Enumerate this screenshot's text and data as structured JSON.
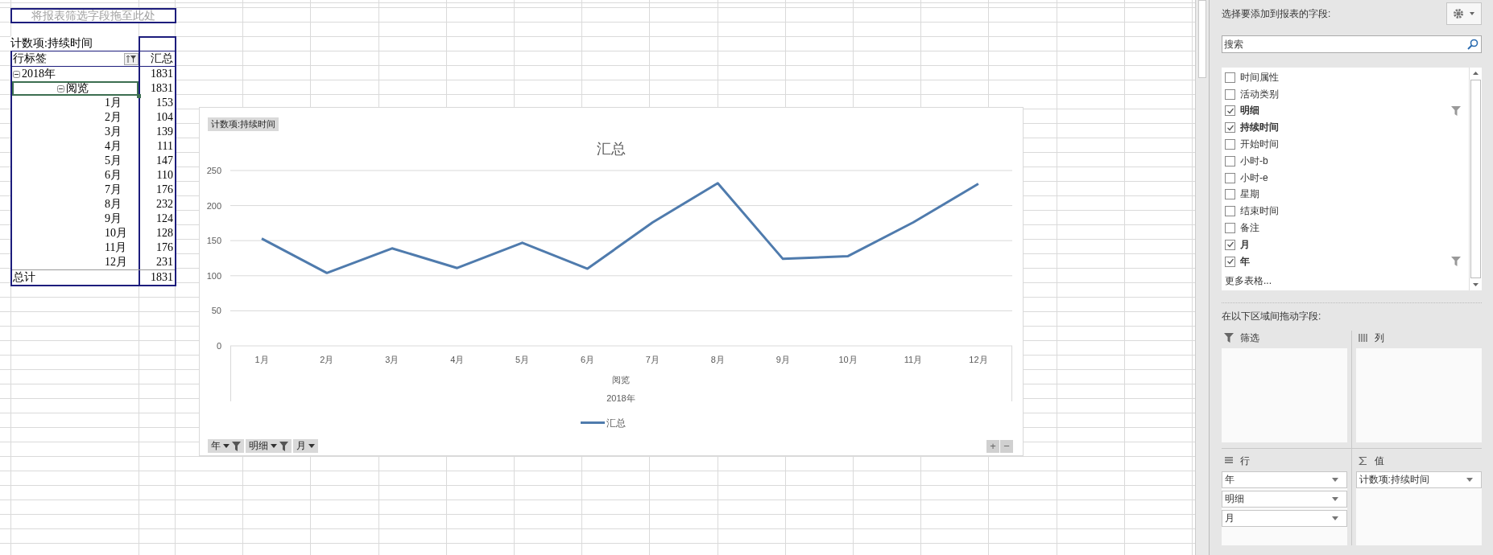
{
  "sheet": {
    "filter_drop_zone": "将报表筛选字段拖至此处",
    "pivot": {
      "value_caption": "计数项:持续时间",
      "header": {
        "row_label": "行标签",
        "total": "汇总"
      },
      "rows": [
        {
          "label": "2018年",
          "total": "1831",
          "expanded": true,
          "selected": false,
          "children": [
            {
              "label": "阅览",
              "total": "1831",
              "expanded": true,
              "selected": true,
              "children": [
                {
                  "label": "1月",
                  "total": "153",
                  "selected": false
                },
                {
                  "label": "2月",
                  "total": "104",
                  "selected": false
                },
                {
                  "label": "3月",
                  "total": "139",
                  "selected": false
                },
                {
                  "label": "4月",
                  "total": "111",
                  "selected": false
                },
                {
                  "label": "5月",
                  "total": "147",
                  "selected": false
                },
                {
                  "label": "6月",
                  "total": "110",
                  "selected": false
                },
                {
                  "label": "7月",
                  "total": "176",
                  "selected": false
                },
                {
                  "label": "8月",
                  "total": "232",
                  "selected": false
                },
                {
                  "label": "9月",
                  "total": "124",
                  "selected": false
                },
                {
                  "label": "10月",
                  "total": "128",
                  "selected": false
                },
                {
                  "label": "11月",
                  "total": "176",
                  "selected": false
                },
                {
                  "label": "12月",
                  "total": "231",
                  "selected": false
                }
              ]
            }
          ]
        }
      ],
      "grand_total": {
        "label": "总计",
        "total": "1831"
      }
    }
  },
  "chart": {
    "field_button": "计数项:持续时间",
    "chart_data": {
      "type": "line",
      "title": "汇总",
      "categories": [
        "1月",
        "2月",
        "3月",
        "4月",
        "5月",
        "6月",
        "7月",
        "8月",
        "9月",
        "10月",
        "11月",
        "12月"
      ],
      "series": [
        {
          "name": "汇总",
          "color": "#4f7bad",
          "values": [
            153,
            104,
            139,
            111,
            147,
            110,
            176,
            232,
            124,
            128,
            176,
            231
          ]
        }
      ],
      "ylim": [
        0,
        250
      ],
      "grid": true,
      "yticks": [
        0,
        50,
        100,
        150,
        200,
        250
      ]
    },
    "category_groups": [
      "阅览",
      "2018年"
    ],
    "axis_fields": [
      {
        "label": "年",
        "filtered": true
      },
      {
        "label": "明细",
        "filtered": true
      },
      {
        "label": "月",
        "filtered": false
      }
    ],
    "zoom_buttons": [
      "+",
      "−"
    ]
  },
  "field_list": {
    "title": "选择要添加到报表的字段:",
    "search": {
      "placeholder": "搜索"
    },
    "fields": [
      {
        "label": "时间属性",
        "checked": false,
        "filtered": false
      },
      {
        "label": "活动类别",
        "checked": false,
        "filtered": false
      },
      {
        "label": "明细",
        "checked": true,
        "filtered": true
      },
      {
        "label": "持续时间",
        "checked": true,
        "filtered": false
      },
      {
        "label": "开始时间",
        "checked": false,
        "filtered": false
      },
      {
        "label": "小时-b",
        "checked": false,
        "filtered": false
      },
      {
        "label": "小时-e",
        "checked": false,
        "filtered": false
      },
      {
        "label": "星期",
        "checked": false,
        "filtered": false
      },
      {
        "label": "结束时间",
        "checked": false,
        "filtered": false
      },
      {
        "label": "备注",
        "checked": false,
        "filtered": false
      },
      {
        "label": "月",
        "checked": true,
        "filtered": false
      },
      {
        "label": "年",
        "checked": true,
        "filtered": true
      }
    ],
    "more_link": "更多表格...",
    "areas_title": "在以下区域间拖动字段:",
    "areas": [
      {
        "kind": "filter",
        "label": "筛选"
      },
      {
        "kind": "columns",
        "label": "列"
      },
      {
        "kind": "rows",
        "label": "行",
        "items": [
          "年",
          "明细",
          "月"
        ]
      },
      {
        "kind": "values",
        "label": "值",
        "items": [
          "计数项:持续时间"
        ]
      }
    ]
  }
}
